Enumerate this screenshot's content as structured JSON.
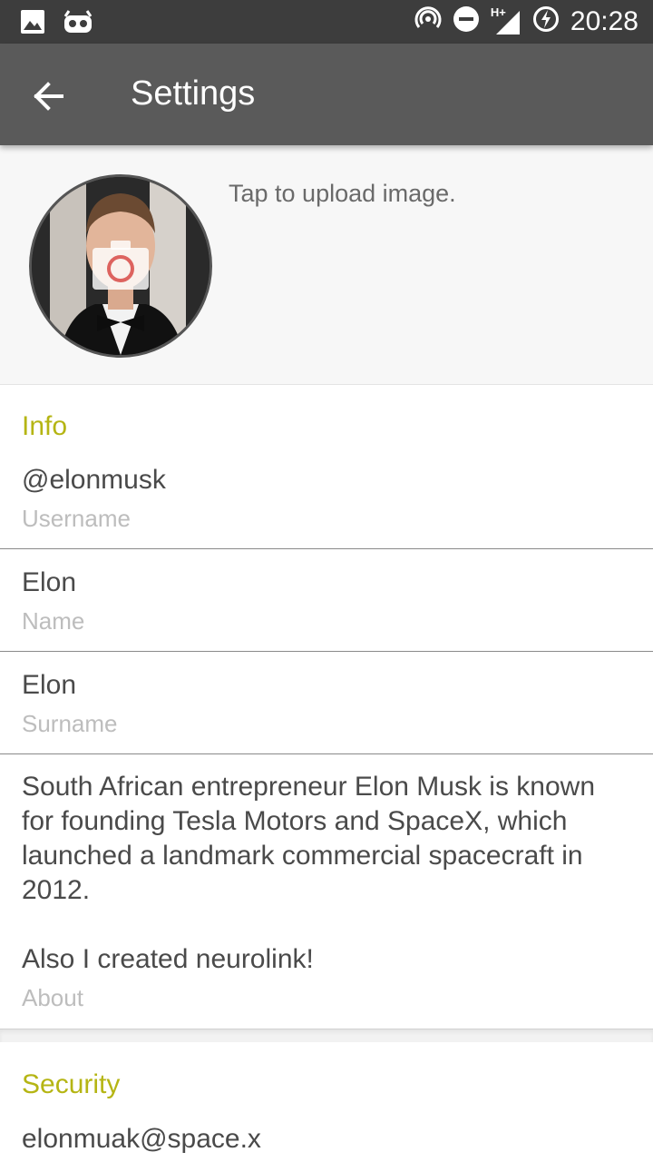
{
  "status_bar": {
    "time": "20:28",
    "network_type": "H+",
    "left_icons": [
      "image-icon",
      "android-cyanogen-icon"
    ],
    "right_icons": [
      "hotspot-icon",
      "do-not-disturb-icon",
      "signal-icon",
      "battery-charging-icon"
    ]
  },
  "app_bar": {
    "title": "Settings",
    "back_icon": "arrow-back-icon"
  },
  "profile": {
    "upload_text": "Tap to upload image."
  },
  "info": {
    "title": "Info",
    "fields": [
      {
        "value": "@elonmusk",
        "label": "Username"
      },
      {
        "value": "Elon",
        "label": "Name"
      },
      {
        "value": "Elon",
        "label": "Surname"
      }
    ],
    "about": {
      "value_lines": [
        "South African entrepreneur Elon Musk is known",
        "for founding Tesla Motors and SpaceX, which",
        "launched a landmark commercial spacecraft in",
        "2012.",
        "",
        "Also I created neurolink!"
      ],
      "label": "About"
    }
  },
  "security": {
    "title": "Security",
    "email": "elonmuak@space.x"
  },
  "colors": {
    "status_bar": "#3d3d3d",
    "app_bar": "#5a5a5a",
    "section_title": "#b5b514",
    "value_text": "#4a4a4a",
    "label_text": "#bdbdbd"
  }
}
